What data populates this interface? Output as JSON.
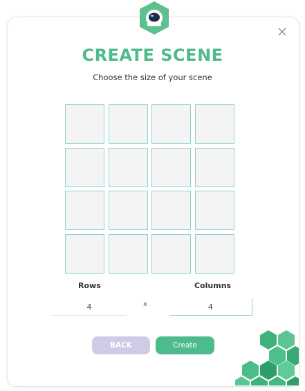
{
  "dialog": {
    "title": "CREATE SCENE",
    "subtitle": "Choose the size of your scene",
    "close_icon": "close-icon",
    "logo_icon": "astronaut-helmet-icon"
  },
  "grid": {
    "rows": 4,
    "columns": 4
  },
  "form": {
    "rows_label": "Rows",
    "columns_label": "Columns",
    "rows_value": "4",
    "columns_value": "4",
    "separator": "x"
  },
  "buttons": {
    "back_label": "BACK",
    "create_label": "Create"
  },
  "colors": {
    "accent_green": "#4dbb8b",
    "cell_border": "#8fcfcf",
    "back_button": "#cdcbe5"
  }
}
